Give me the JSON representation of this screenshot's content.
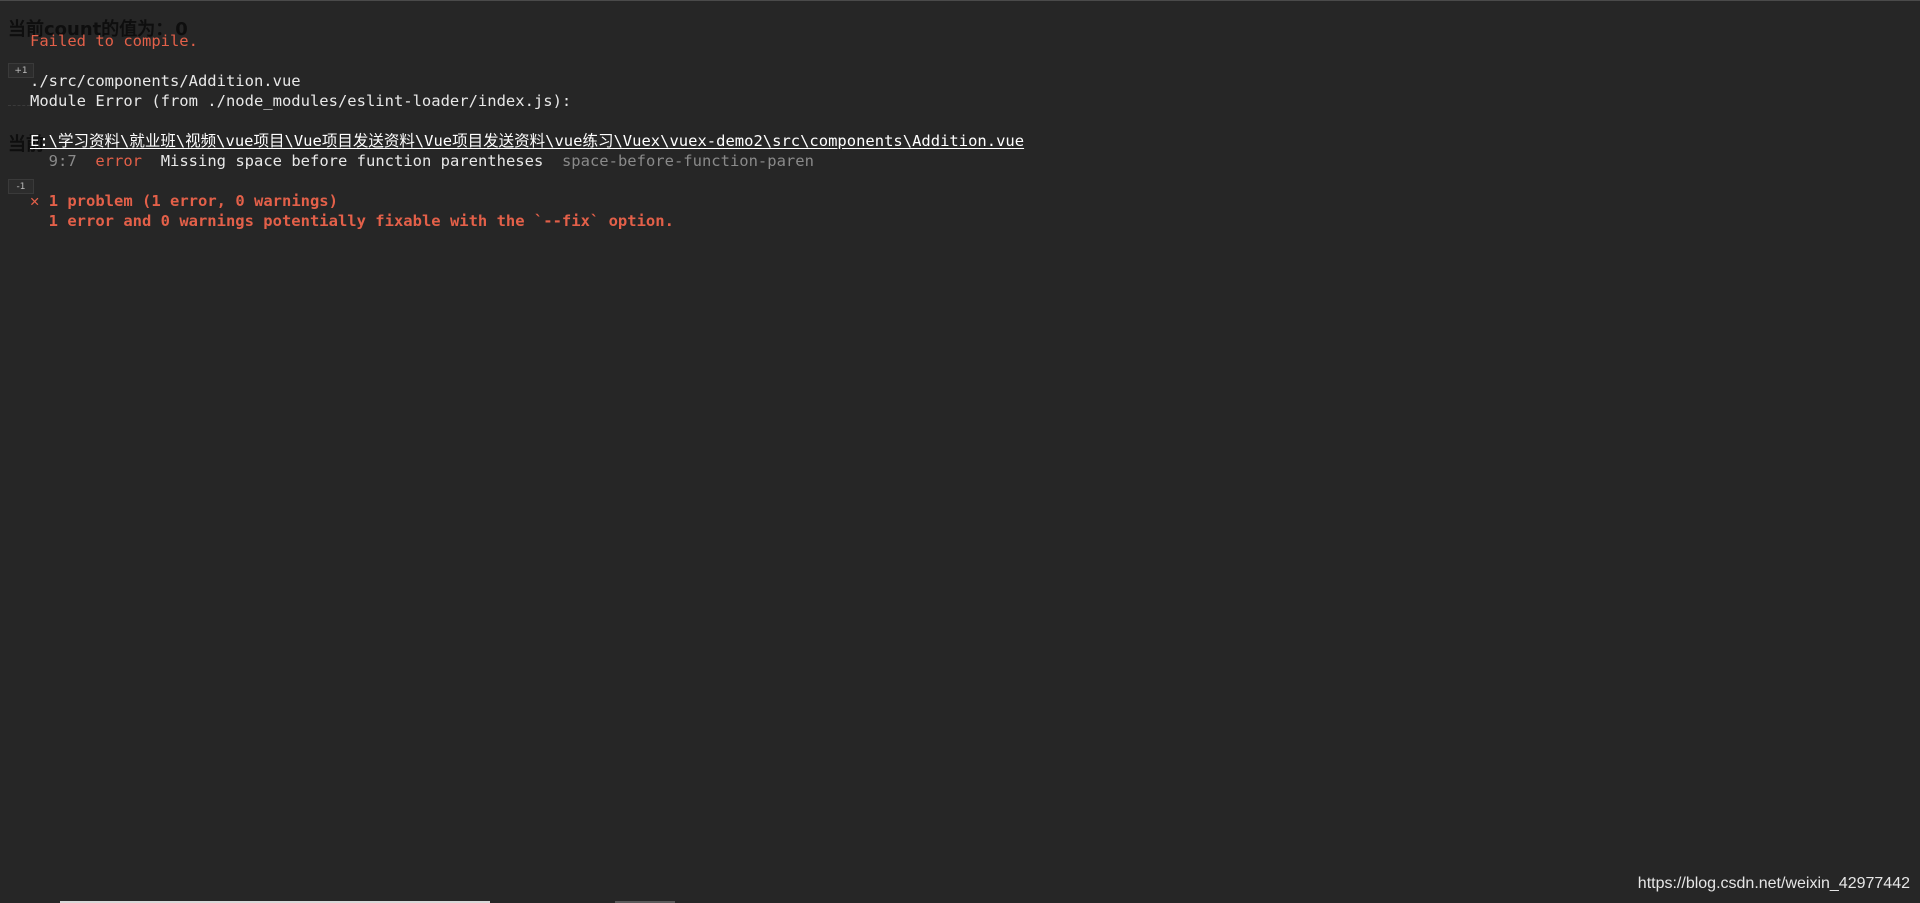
{
  "app": {
    "count_heading_1": "当前count的值为：",
    "count_value_1": "0",
    "plus_button": "+1",
    "count_heading_2": "当前",
    "minus_button": "-1"
  },
  "overlay": {
    "title": "Failed to compile.",
    "file": "./src/components/Addition.vue",
    "module_error": "Module Error (from ./node_modules/eslint-loader/index.js):",
    "absolute_path": "E:\\学习资料\\就业班\\视频\\vue项目\\Vue项目发送资料\\Vue项目发送资料\\vue练习\\Vuex\\vuex-demo2\\src\\components\\Addition.vue",
    "error": {
      "location": "9:7",
      "severity": "error",
      "message": "Missing space before function parentheses",
      "rule": "space-before-function-paren"
    },
    "summary_icon": "✕",
    "summary": "1 problem (1 error, 0 warnings)",
    "fixable": "1 error and 0 warnings potentially fixable with the `--fix` option."
  },
  "watermark": "https://blog.csdn.net/weixin_42977442",
  "colors": {
    "background": "#262626",
    "error_red": "#e36049",
    "text": "#e8e8e8",
    "muted": "#8a8a8a"
  }
}
